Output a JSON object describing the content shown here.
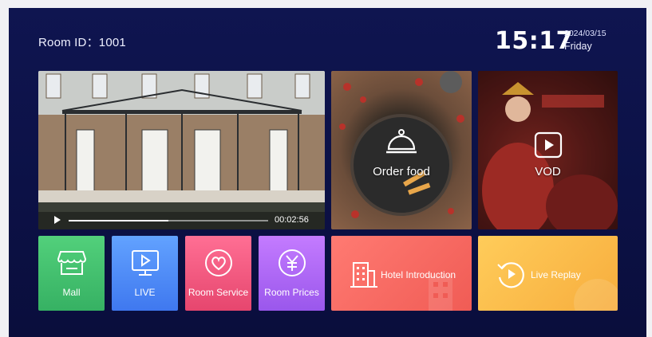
{
  "header": {
    "room_id": "Room ID：1001",
    "time": "15:17",
    "date": "2024/03/15",
    "weekday": "Friday"
  },
  "video": {
    "elapsed": "00:02:56",
    "progress": 0.5
  },
  "tiles": {
    "order_food": "Order food",
    "vod": "VOD",
    "mall": "Mall",
    "live": "LIVE",
    "room_service": "Room Service",
    "room_prices": "Room Prices",
    "hotel_intro": "Hotel Introduction",
    "live_replay": "Live Replay"
  },
  "icons": {
    "order_food": "cloche-icon",
    "vod": "play-icon",
    "mall": "store-icon",
    "live": "tv-icon",
    "room_service": "heart-icon",
    "room_prices": "yen-icon",
    "hotel_intro": "building-icon",
    "live_replay": "replay-icon"
  },
  "colors": {
    "background": "#0c1146",
    "mall": "#3fbf6c",
    "live": "#4c88f5",
    "room_service": "#f0577e",
    "room_prices": "#a966f2",
    "hotel_intro": "#f4665e",
    "live_replay": "#fbbd4a"
  }
}
